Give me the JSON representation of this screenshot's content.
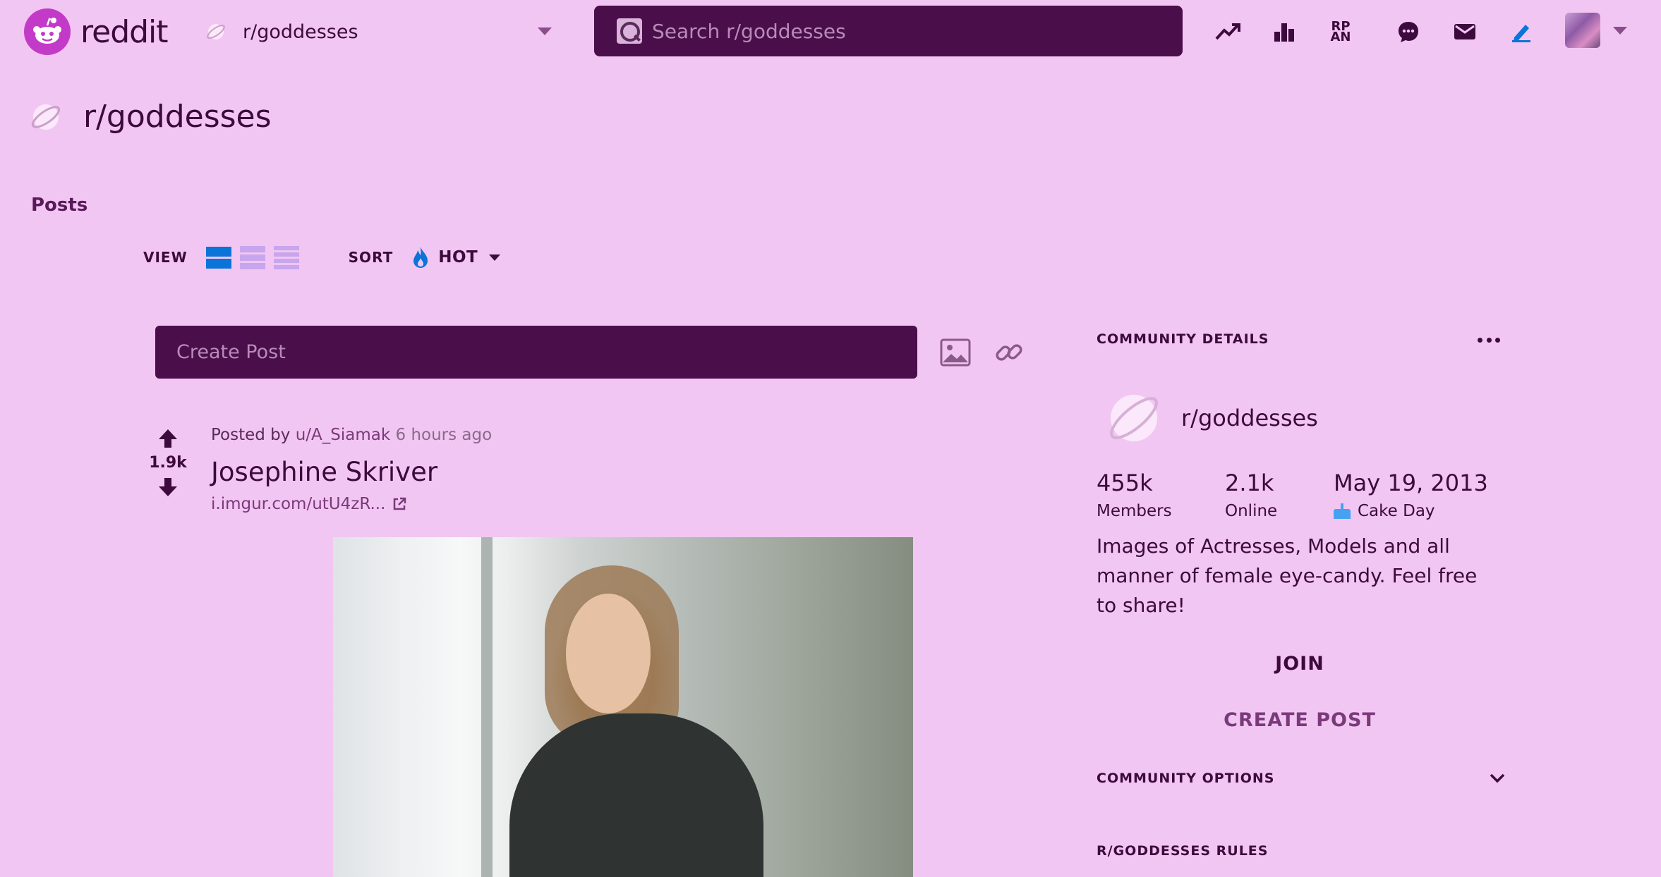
{
  "header": {
    "logo_text": "reddit",
    "community_switch": {
      "name": "r/goddesses",
      "icon": "planet-icon"
    },
    "search": {
      "placeholder": "Search r/goddesses",
      "icon": "search-icon"
    },
    "icons": [
      "trending-icon",
      "leaderboard-icon",
      "rpan-icon",
      "chat-icon",
      "mail-icon",
      "pencil-icon"
    ],
    "rpan_text": "RP AN",
    "accent_color": "#4a0f4a"
  },
  "subreddit": {
    "title": "r/goddesses",
    "posts_label": "Posts"
  },
  "viewbar": {
    "view_label": "VIEW",
    "sort_label": "SORT",
    "sort_value": "HOT",
    "active_view": "card",
    "active_color": "#0a74d8"
  },
  "create_post": {
    "placeholder": "Create Post"
  },
  "post": {
    "score": "1.9k",
    "posted_by_label": "Posted by",
    "user": "u/A_Siamak",
    "time": "6 hours ago",
    "title": "Josephine Skriver",
    "link": "i.imgur.com/utU4zR..."
  },
  "sidebar": {
    "heading": "COMMUNITY DETAILS",
    "community_name": "r/goddesses",
    "stats": [
      {
        "value": "455k",
        "label": "Members"
      },
      {
        "value": "2.1k",
        "label": "Online"
      },
      {
        "value": "May 19, 2013",
        "label": "Cake Day"
      }
    ],
    "description": "Images of Actresses, Models and all manner of female eye-candy. Feel free to share!",
    "join_label": "JOIN",
    "create_post_label": "CREATE POST",
    "options_label": "COMMUNITY OPTIONS",
    "rules_label": "R/GODDESSES RULES"
  },
  "colors": {
    "background": "#f2c6f2",
    "text": "#3c0a3c",
    "input_bg": "#4a0f4a",
    "logo": "#c43ac8"
  }
}
